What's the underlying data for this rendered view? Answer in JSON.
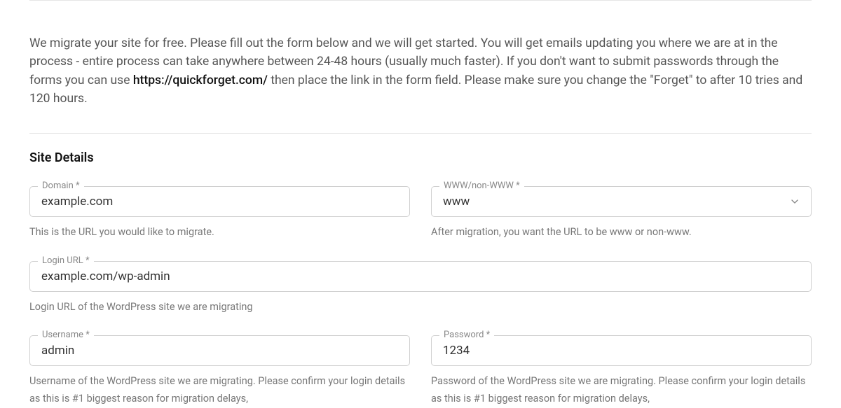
{
  "intro": {
    "before_link": "We migrate your site for free. Please fill out the form below and we will get started. You will get emails updating you where we are at in the process - entire process can take anywhere between 24-48 hours (usually much faster). If you don't want to submit passwords through the forms you can use ",
    "link_text": "https://quickforget.com/",
    "after_link": " then place the link in the form field. Please make sure you change the \"Forget\" to after 10 tries and 120 hours."
  },
  "section_title": "Site Details",
  "fields": {
    "domain": {
      "label": "Domain *",
      "value": "example.com",
      "helper": "This is the URL you would like to migrate."
    },
    "www": {
      "label": "WWW/non-WWW *",
      "value": "www",
      "helper": "After migration, you want the URL to be www or non-www."
    },
    "login_url": {
      "label": "Login URL *",
      "value": "example.com/wp-admin",
      "helper": "Login URL of the WordPress site we are migrating"
    },
    "username": {
      "label": "Username *",
      "value": "admin",
      "helper": "Username of the WordPress site we are migrating. Please confirm your login details as this is #1 biggest reason for migration delays,"
    },
    "password": {
      "label": "Password *",
      "value": "1234",
      "helper": "Password of the WordPress site we are migrating. Please confirm your login details as this is #1 biggest reason for migration delays,"
    }
  }
}
